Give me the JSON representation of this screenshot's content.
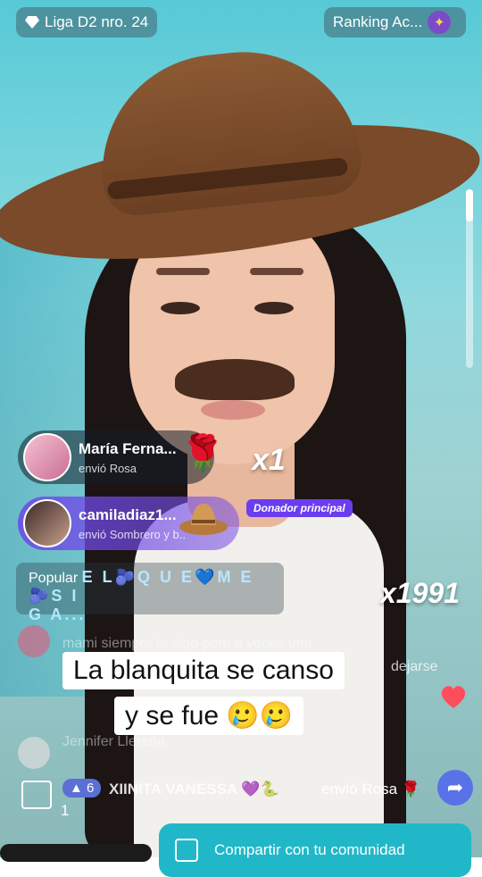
{
  "top": {
    "league_label": "Liga D2 nro. 24",
    "ranking_label": "Ranking Ac...",
    "ranking_icon": "star-badge-icon"
  },
  "gifts": [
    {
      "name": "María Ferna...",
      "sub": "envió Rosa",
      "combo": "x1",
      "gift_icon": "rose-icon"
    },
    {
      "name": "camiladiaz1...",
      "sub": "envió Sombrero y b...",
      "badge": "Donador principal",
      "gift_icon": "hat-icon"
    }
  ],
  "popular": {
    "label": "Popular",
    "name_line1": "E L🫐Q U E💙M E🫐S I",
    "name_line2": "G A...",
    "combo": "x1991"
  },
  "comments": [
    {
      "text": "mami siempre te sigo pero a veces una",
      "text2": "dejarse"
    },
    {
      "text": "Jennifer Llerena"
    }
  ],
  "caption": {
    "line1": "La blanquita se canso",
    "line2": "y se fue 🥲🥲"
  },
  "bottom": {
    "level": "6",
    "username": "XIINITA VANESSA 💜🐍",
    "action": "envió Rosa 🌹",
    "count": "1"
  },
  "share": {
    "label": "Compartir con tu comunidad"
  },
  "colors": {
    "accent_purple": "#6a3df0",
    "share_teal": "#20b8c8",
    "heart_red": "#ff4d5e"
  }
}
